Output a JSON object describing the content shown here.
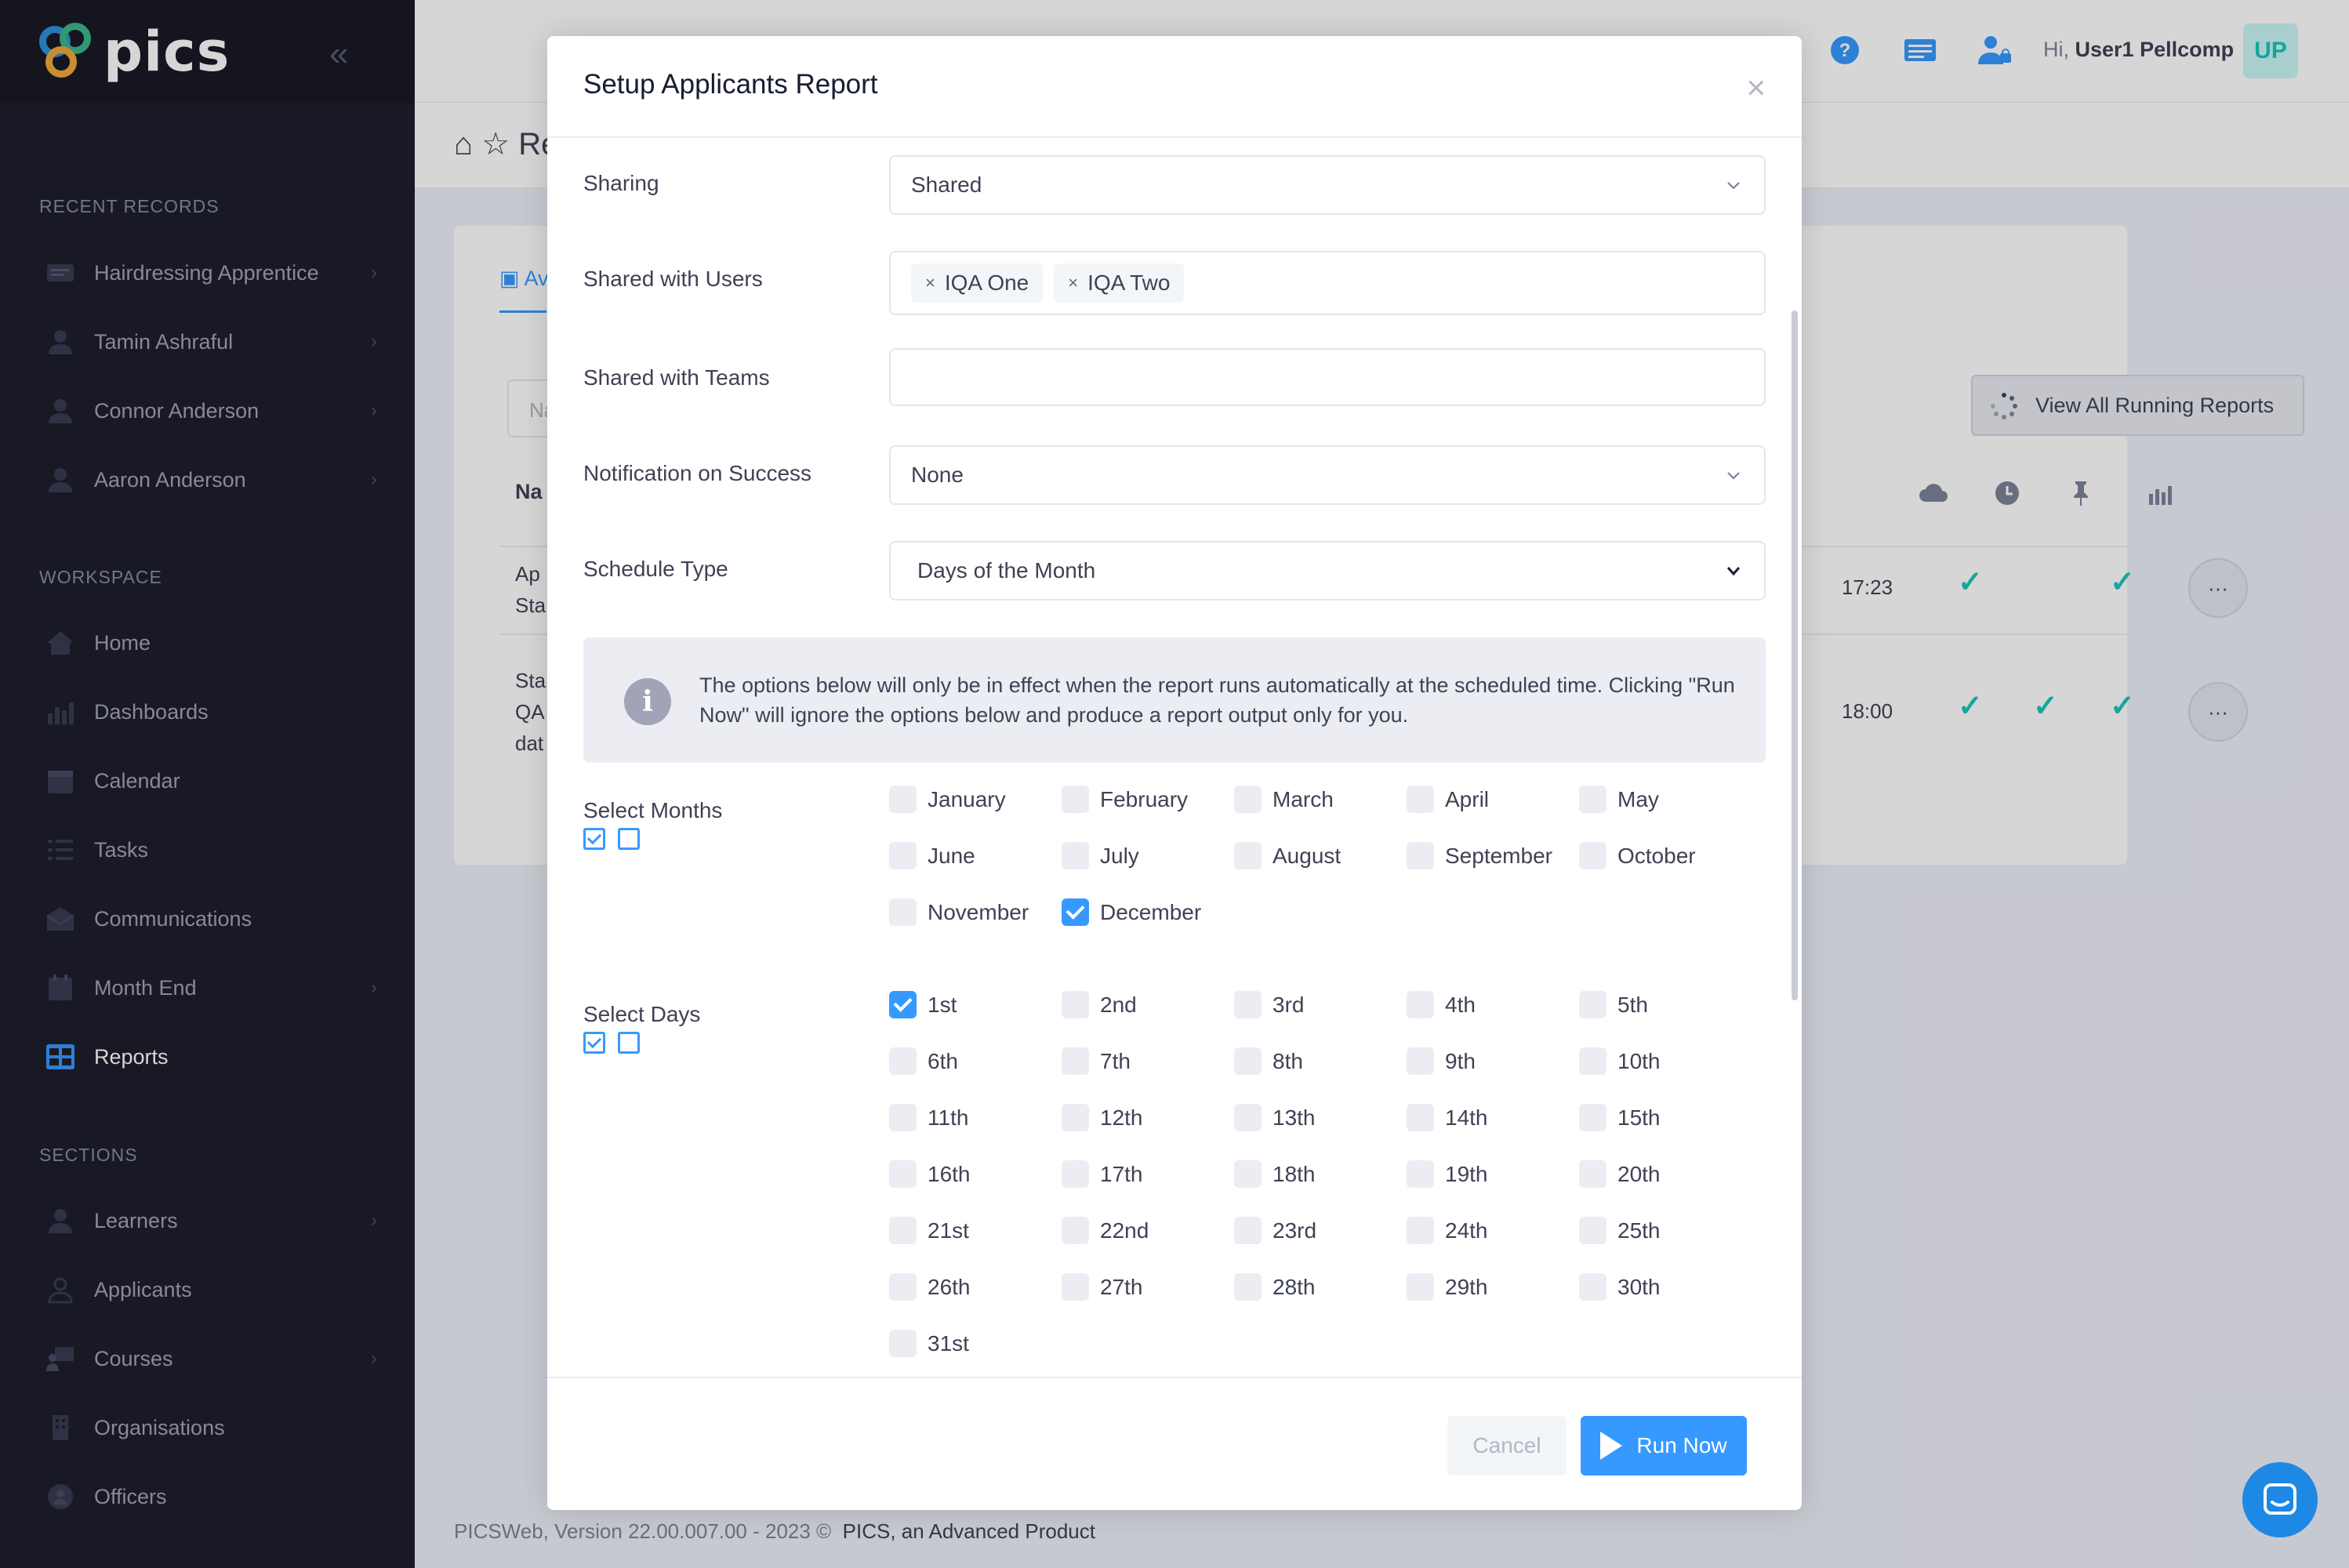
{
  "app": {
    "logo_text": "pics"
  },
  "sidebar": {
    "recent_title": "RECENT RECORDS",
    "recent": [
      {
        "label": "Hairdressing Apprentice"
      },
      {
        "label": "Tamin Ashraful"
      },
      {
        "label": "Connor Anderson"
      },
      {
        "label": "Aaron Anderson"
      }
    ],
    "workspace_title": "WORKSPACE",
    "workspace": [
      {
        "label": "Home"
      },
      {
        "label": "Dashboards"
      },
      {
        "label": "Calendar"
      },
      {
        "label": "Tasks"
      },
      {
        "label": "Communications"
      },
      {
        "label": "Month End"
      },
      {
        "label": "Reports"
      }
    ],
    "sections_title": "SECTIONS",
    "sections": [
      {
        "label": "Learners"
      },
      {
        "label": "Applicants"
      },
      {
        "label": "Courses"
      },
      {
        "label": "Organisations"
      },
      {
        "label": "Officers"
      }
    ]
  },
  "topbar": {
    "greeting": "Hi,",
    "user_name": "User1 Pellcomp",
    "avatar_initials": "UP"
  },
  "page": {
    "breadcrumb_partial": "Re",
    "tab_partial": "Av",
    "search_partial": "Na",
    "name_col_partial": "Na",
    "row1_lines": [
      "Ap",
      "Sta"
    ],
    "row2_lines": [
      "Sta",
      "QA",
      "dat"
    ],
    "view_running_label": "View All Running Reports",
    "row1_time": "17:23",
    "row2_time": "18:00",
    "row_menu_glyph": "···"
  },
  "footer": {
    "version": "PICSWeb, Version 22.00.007.00 - 2023 ©",
    "product": "PICS, an Advanced Product"
  },
  "modal": {
    "title": "Setup Applicants Report",
    "sharing_label": "Sharing",
    "sharing_value": "Shared",
    "shared_users_label": "Shared with Users",
    "shared_users": [
      "IQA One",
      "IQA Two"
    ],
    "shared_teams_label": "Shared with Teams",
    "notification_label": "Notification on Success",
    "notification_value": "None",
    "schedule_label": "Schedule Type",
    "schedule_value": "Days of the Month",
    "info_text": "The options below will only be in effect when the report runs automatically at the scheduled time. Clicking \"Run Now\" will ignore the options below and produce a report output only for you.",
    "months_label": "Select Months",
    "months": [
      {
        "label": "January",
        "checked": false
      },
      {
        "label": "February",
        "checked": false
      },
      {
        "label": "March",
        "checked": false
      },
      {
        "label": "April",
        "checked": false
      },
      {
        "label": "May",
        "checked": false
      },
      {
        "label": "June",
        "checked": false
      },
      {
        "label": "July",
        "checked": false
      },
      {
        "label": "August",
        "checked": false
      },
      {
        "label": "September",
        "checked": false
      },
      {
        "label": "October",
        "checked": false
      },
      {
        "label": "November",
        "checked": false
      },
      {
        "label": "December",
        "checked": true
      }
    ],
    "days_label": "Select Days",
    "days": [
      {
        "label": "1st",
        "checked": true
      },
      {
        "label": "2nd",
        "checked": false
      },
      {
        "label": "3rd",
        "checked": false
      },
      {
        "label": "4th",
        "checked": false
      },
      {
        "label": "5th",
        "checked": false
      },
      {
        "label": "6th",
        "checked": false
      },
      {
        "label": "7th",
        "checked": false
      },
      {
        "label": "8th",
        "checked": false
      },
      {
        "label": "9th",
        "checked": false
      },
      {
        "label": "10th",
        "checked": false
      },
      {
        "label": "11th",
        "checked": false
      },
      {
        "label": "12th",
        "checked": false
      },
      {
        "label": "13th",
        "checked": false
      },
      {
        "label": "14th",
        "checked": false
      },
      {
        "label": "15th",
        "checked": false
      },
      {
        "label": "16th",
        "checked": false
      },
      {
        "label": "17th",
        "checked": false
      },
      {
        "label": "18th",
        "checked": false
      },
      {
        "label": "19th",
        "checked": false
      },
      {
        "label": "20th",
        "checked": false
      },
      {
        "label": "21st",
        "checked": false
      },
      {
        "label": "22nd",
        "checked": false
      },
      {
        "label": "23rd",
        "checked": false
      },
      {
        "label": "24th",
        "checked": false
      },
      {
        "label": "25th",
        "checked": false
      },
      {
        "label": "26th",
        "checked": false
      },
      {
        "label": "27th",
        "checked": false
      },
      {
        "label": "28th",
        "checked": false
      },
      {
        "label": "29th",
        "checked": false
      },
      {
        "label": "30th",
        "checked": false
      },
      {
        "label": "31st",
        "checked": false
      }
    ],
    "cancel_label": "Cancel",
    "run_label": "Run Now"
  },
  "colors": {
    "primary": "#3699ff",
    "sidebar_bg": "#1e1e2d",
    "success": "#1bc5bd"
  }
}
